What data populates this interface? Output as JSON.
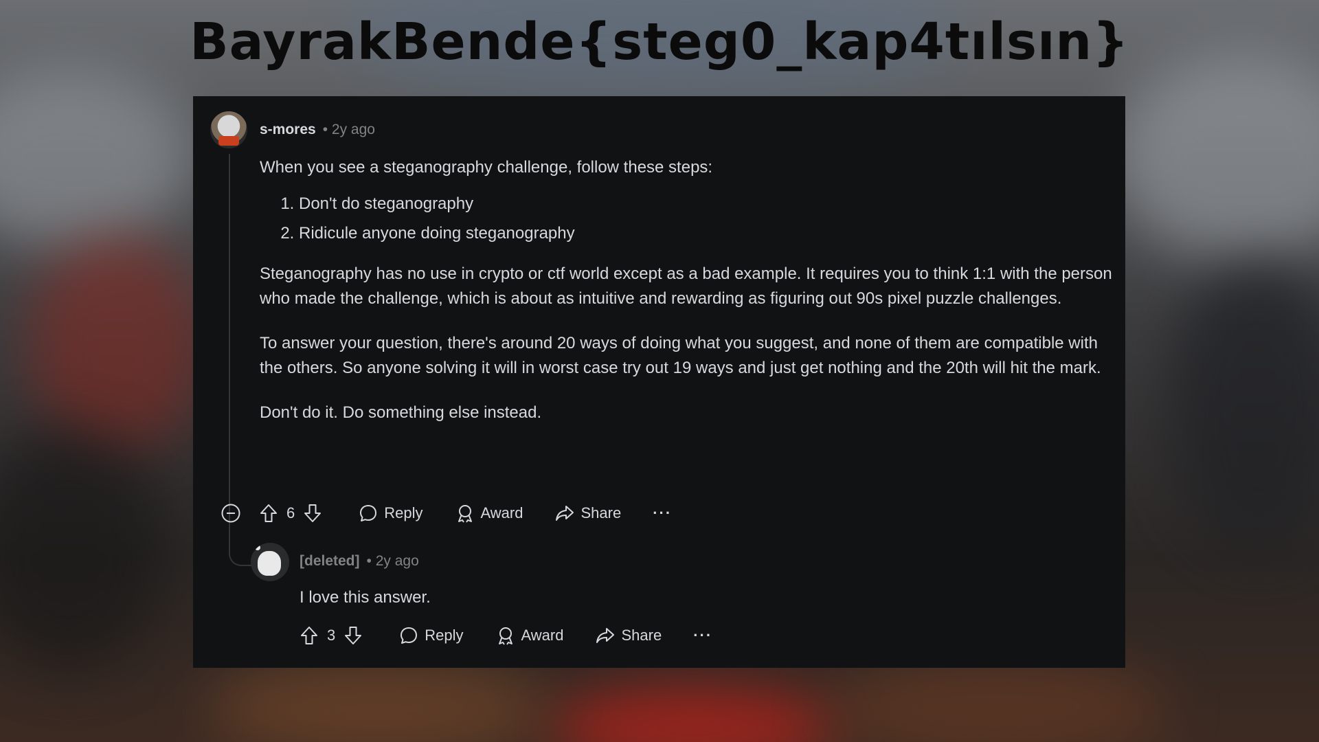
{
  "overlay": {
    "title": "BayrakBende{steg0_kap4tılsın}"
  },
  "comment": {
    "username": "s-mores",
    "time": "• 2y ago",
    "intro": "When you see a steganography challenge, follow these steps:",
    "steps": [
      "Don't do steganography",
      "Ridicule anyone doing steganography"
    ],
    "paragraph2": "Steganography has no use in crypto or ctf world except as a bad example. It requires you to think 1:1 with the person who made the challenge, which is about as intuitive and rewarding as figuring out 90s pixel puzzle challenges.",
    "paragraph3": "To answer your question, there's around 20 ways of doing what you suggest, and none of them are compatible with the others. So anyone solving it will in worst case try out 19 ways and just get nothing and the 20th will hit the mark.",
    "paragraph4": "Don't do it. Do something else instead.",
    "votes": "6",
    "reply_label": "Reply",
    "award_label": "Award",
    "share_label": "Share",
    "more_label": "···"
  },
  "reply": {
    "username": "[deleted]",
    "time": "• 2y ago",
    "text": "I love this answer.",
    "votes": "3",
    "reply_label": "Reply",
    "award_label": "Award",
    "share_label": "Share",
    "more_label": "···"
  }
}
